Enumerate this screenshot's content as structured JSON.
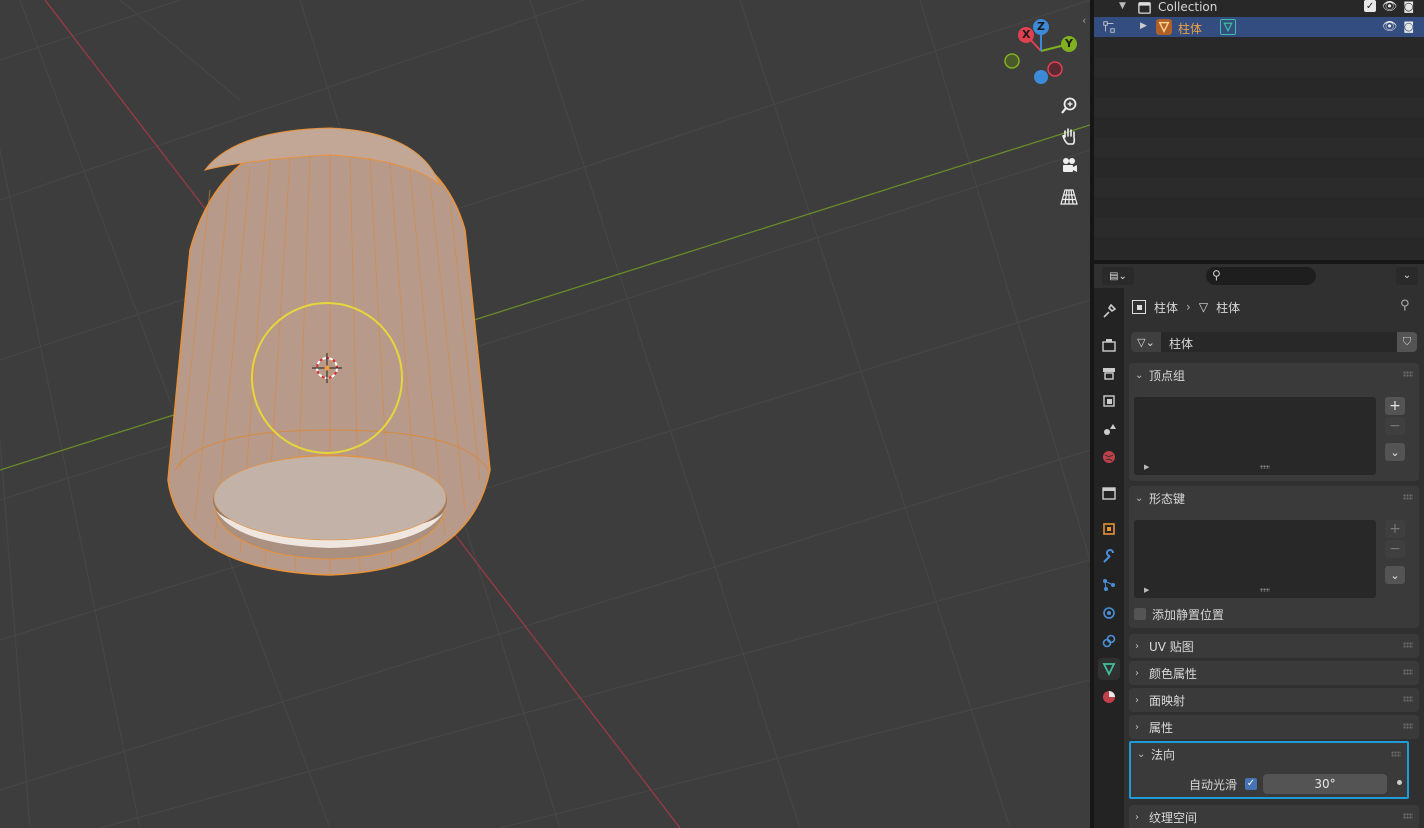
{
  "outliner": {
    "collection_label": "Collection",
    "object_label": "柱体"
  },
  "properties": {
    "breadcrumb": {
      "object": "柱体",
      "data": "柱体"
    },
    "mesh_name": "柱体",
    "panels": {
      "vertex_groups": "顶点组",
      "shape_keys": "形态键",
      "add_rest_position": "添加静置位置",
      "uv_maps": "UV 贴图",
      "color_attributes": "颜色属性",
      "face_maps": "面映射",
      "attributes": "属性",
      "normals": "法向",
      "auto_smooth_label": "自动光滑",
      "auto_smooth_angle": "30°",
      "texture_space": "纹理空间"
    }
  },
  "gizmo": {
    "x": "X",
    "y": "Y",
    "z": "Z"
  },
  "colors": {
    "accent_selected": "#334d80",
    "outline_active": "#1f9bd7",
    "object_orange": "#e8923a",
    "x_axis": "#e04050",
    "y_axis": "#80b020",
    "z_axis": "#3d8ad9"
  }
}
